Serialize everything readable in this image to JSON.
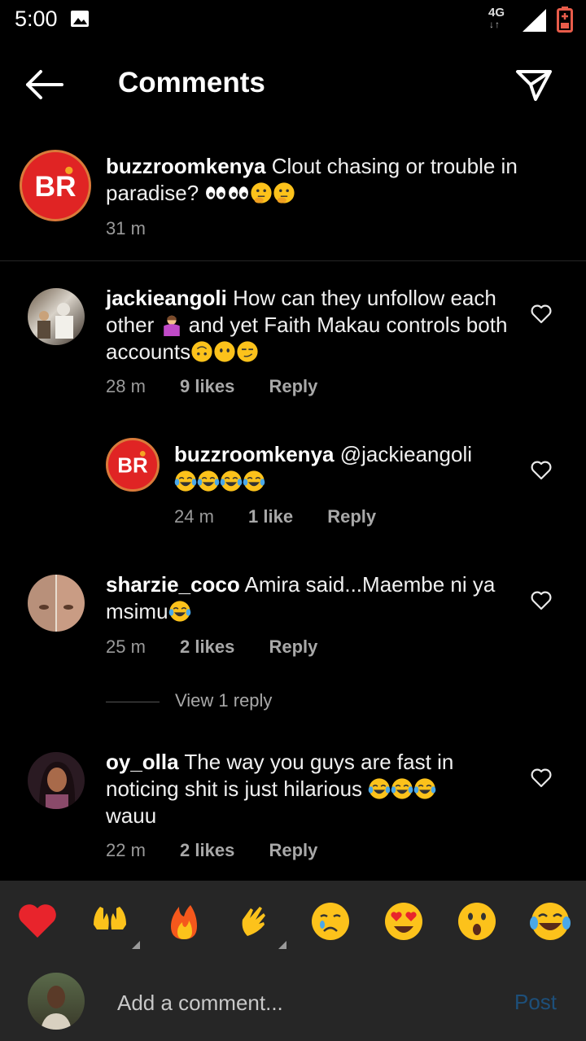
{
  "status_bar": {
    "time": "5:00",
    "network": "4G",
    "network_arrows": "↓↑"
  },
  "header": {
    "title": "Comments"
  },
  "caption": {
    "username": "buzzroomkenya",
    "text": "Clout chasing or trouble in paradise?",
    "emojis": [
      "eyes-icon",
      "eyes-icon",
      "thinking-face-icon",
      "thinking-face-icon"
    ],
    "time": "31 m"
  },
  "comments": [
    {
      "username": "jackieangoli",
      "text_part1": "How can they unfollow each other",
      "text_part2": "and yet Faith Makau controls both accounts",
      "emojis": [
        "person-shrugging-icon",
        "upside-down-face-icon",
        "face-without-mouth-icon",
        "smirking-face-icon"
      ],
      "time": "28 m",
      "likes": "9 likes",
      "reply": "Reply"
    },
    {
      "username": "buzzroomkenya",
      "mention": "@jackieangoli",
      "emojis": [
        "tears-of-joy-icon",
        "tears-of-joy-icon",
        "tears-of-joy-icon",
        "tears-of-joy-icon"
      ],
      "time": "24 m",
      "likes": "1 like",
      "reply": "Reply"
    },
    {
      "username": "sharzie_coco",
      "text": "Amira said...Maembe ni ya msimu",
      "emojis": [
        "tears-of-joy-icon"
      ],
      "time": "25 m",
      "likes": "2 likes",
      "reply": "Reply",
      "view_replies": "View 1 reply"
    },
    {
      "username": "oy_olla",
      "text_part1": "The way you guys are fast in noticing shit is just hilarious",
      "text_part2": "wauu",
      "emojis": [
        "tears-of-joy-icon",
        "tears-of-joy-icon",
        "tears-of-joy-icon"
      ],
      "time": "22 m",
      "likes": "2 likes",
      "reply": "Reply"
    }
  ],
  "emoji_bar": [
    "red-heart-icon",
    "raising-hands-icon",
    "fire-icon",
    "clapping-hands-icon",
    "crying-face-icon",
    "heart-eyes-icon",
    "astonished-face-icon",
    "tears-of-joy-icon"
  ],
  "input": {
    "placeholder": "Add a comment...",
    "post_label": "Post"
  },
  "colors": {
    "background": "#000000",
    "panel": "#262626",
    "post_disabled": "#1d4f7a",
    "br_logo_red": "#e02424"
  }
}
